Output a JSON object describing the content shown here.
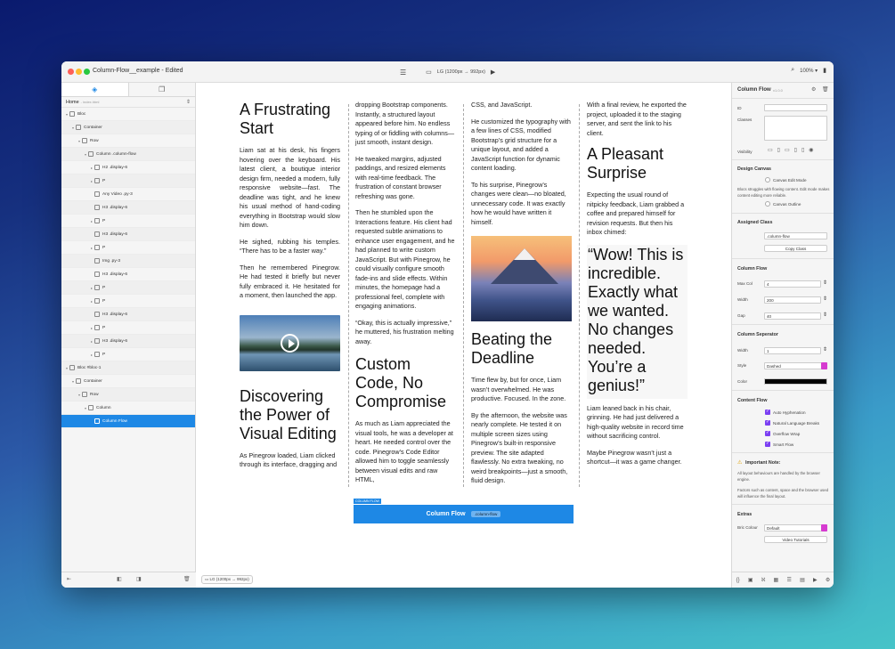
{
  "window": {
    "title": "Column-Flow__example - Edited"
  },
  "toolbar": {
    "breakpoint": "LG (1200px → 992px)",
    "zoom": "100% ▾"
  },
  "left_panel": {
    "home_label": "Home",
    "home_sub": "- index.html",
    "tree": [
      {
        "label": "Bloc",
        "indent": 0,
        "tri": "▾"
      },
      {
        "label": "Container",
        "indent": 1,
        "tri": "▾"
      },
      {
        "label": "Row",
        "indent": 2,
        "tri": "▾"
      },
      {
        "label": "Column .column-flow",
        "indent": 3,
        "tri": "▾"
      },
      {
        "label": "H2 .display-6",
        "indent": 4,
        "tri": "▸"
      },
      {
        "label": "P",
        "indent": 4,
        "tri": "▸"
      },
      {
        "label": "Any Video .py-3",
        "indent": 4,
        "tri": ""
      },
      {
        "label": "H3 .display-6",
        "indent": 4,
        "tri": ""
      },
      {
        "label": "P",
        "indent": 4,
        "tri": "▸"
      },
      {
        "label": "H3 .display-6",
        "indent": 4,
        "tri": ""
      },
      {
        "label": "P",
        "indent": 4,
        "tri": "▸"
      },
      {
        "label": "Img .py-3",
        "indent": 4,
        "tri": ""
      },
      {
        "label": "H3 .display-6",
        "indent": 4,
        "tri": ""
      },
      {
        "label": "P",
        "indent": 4,
        "tri": "▸"
      },
      {
        "label": "P",
        "indent": 4,
        "tri": "▸"
      },
      {
        "label": "H3 .display-6",
        "indent": 4,
        "tri": ""
      },
      {
        "label": "P",
        "indent": 4,
        "tri": "▸"
      },
      {
        "label": "H3 .display-6",
        "indent": 4,
        "tri": "▸"
      },
      {
        "label": "P",
        "indent": 4,
        "tri": "▸"
      },
      {
        "label": "Bloc #bloc-1",
        "indent": 0,
        "tri": "▾"
      },
      {
        "label": "Container",
        "indent": 1,
        "tri": "▾"
      },
      {
        "label": "Row",
        "indent": 2,
        "tri": "▾"
      },
      {
        "label": "Column",
        "indent": 3,
        "tri": "▾"
      },
      {
        "label": "Column Flow",
        "indent": 4,
        "tri": "",
        "selected": true
      }
    ]
  },
  "canvas": {
    "col1": {
      "h2": "A Frustrating Start",
      "p1": "Liam sat at his desk, his fingers hovering over the keyboard. His latest client, a boutique interior design firm, needed a modern, fully responsive website—fast. The deadline was tight, and he knew his usual method of hand-coding everything in Bootstrap would slow him down.",
      "p2": "He sighed, rubbing his temples. “There has to be a faster way.”",
      "p3": "Then he remembered Pinegrow. He had tested it briefly but never fully embraced it. He hesitated for a moment, then launched the app.",
      "h3": "Discovering the Power of Visual Editing",
      "p4": "As Pinegrow loaded, Liam clicked through its interface, dragging and"
    },
    "col2": {
      "p1": "dropping Bootstrap components. Instantly, a structured layout appeared before him. No endless typing of or fiddling with columns—just smooth, instant design.",
      "p2": "He tweaked margins, adjusted paddings, and resized elements with real-time feedback. The frustration of constant browser refreshing was gone.",
      "p3": "Then he stumbled upon the Interactions feature. His client had requested subtle animations to enhance user engagement, and he had planned to write custom JavaScript. But with Pinegrow, he could visually configure smooth fade-ins and slide effects. Within minutes, the homepage had a professional feel, complete with engaging animations.",
      "p4": "“Okay, this is actually impressive,” he muttered, his frustration melting away.",
      "h3": "Custom Code, No Compromise",
      "p5": "As much as Liam appreciated the visual tools, he was a developer at heart. He needed control over the code. Pinegrow’s Code Editor allowed him to toggle seamlessly between visual edits and raw HTML,"
    },
    "col3": {
      "p1": "CSS, and JavaScript.",
      "p2": "He customized the typography with a few lines of CSS, modified Bootstrap’s grid structure for a unique layout, and added a JavaScript function for dynamic content loading.",
      "p3": "To his surprise, Pinegrow’s changes were clean—no bloated, unnecessary code. It was exactly how he would have written it himself.",
      "h3": "Beating the Deadline",
      "p4": "Time flew by, but for once, Liam wasn’t overwhelmed. He was productive. Focused. In the zone.",
      "p5": "By the afternoon, the website was nearly complete. He tested it on multiple screen sizes using Pinegrow’s built-in responsive preview. The site adapted flawlessly. No extra tweaking, no weird breakpoints—just a smooth, fluid design."
    },
    "col4": {
      "p1": "With a final review, he exported the project, uploaded it to the staging server, and sent the link to his client.",
      "h3": "A Pleasant Surprise",
      "p2": "Expecting the usual round of nitpicky feedback, Liam grabbed a coffee and prepared himself for revision requests. But then his inbox chimed:",
      "quote": "“Wow! This is incredible. Exactly what we wanted. No changes needed. You’re a genius!”",
      "p3": "Liam leaned back in his chair, grinning. He had just delivered a high-quality website in record time without sacrificing control.",
      "p4": "Maybe Pinegrow wasn’t just a shortcut—it was a game changer."
    },
    "column_flow": {
      "tag": "COLUMN FLOW",
      "label": "Column Flow",
      "class": ".column-flow"
    },
    "breakpoint": "LG (1200px → 992px)"
  },
  "right_panel": {
    "title": "Column Flow",
    "version": "v1.0.0",
    "id_label": "ID",
    "classes_label": "Classes",
    "visibility_label": "Visibility",
    "design_canvas": "Design Canvas",
    "canvas_edit_mode": "Canvas Edit Mode",
    "canvas_note": "Blocs struggles with flowing content. Edit mode makes content editing more reliable.",
    "canvas_outline": "Canvas Outline",
    "assigned_class": "Assigned Class",
    "class_value": ".column-flow",
    "copy_class": "Copy Class",
    "column_flow": "Column Flow",
    "max_col_label": "Max Col",
    "max_col": "4",
    "width_label": "Width",
    "width": "200",
    "gap_label": "Gap",
    "gap": "40",
    "separator": "Column Seperator",
    "sep_width_label": "Width",
    "sep_width": "1",
    "style_label": "Style",
    "style": "Dashed",
    "color_label": "Color",
    "content_flow": "Content Flow",
    "checks": [
      "Auto Hyphenation",
      "Natural Language Breaks",
      "Overflow Wrap",
      "Smart Flow"
    ],
    "important": "Important Note:",
    "note1": "All layout behaviours are handled by the browser engine.",
    "note2": "Factors such as content, space and the browser used will influence the final layout.",
    "extras": "Extras",
    "bric_label": "Bric Colour",
    "bric": "Default",
    "tutorials": "Video Tutorials"
  },
  "colors": {
    "accent": "#1e88e5",
    "check": "#7b3ff2",
    "dropdown": "#d63bd0"
  }
}
